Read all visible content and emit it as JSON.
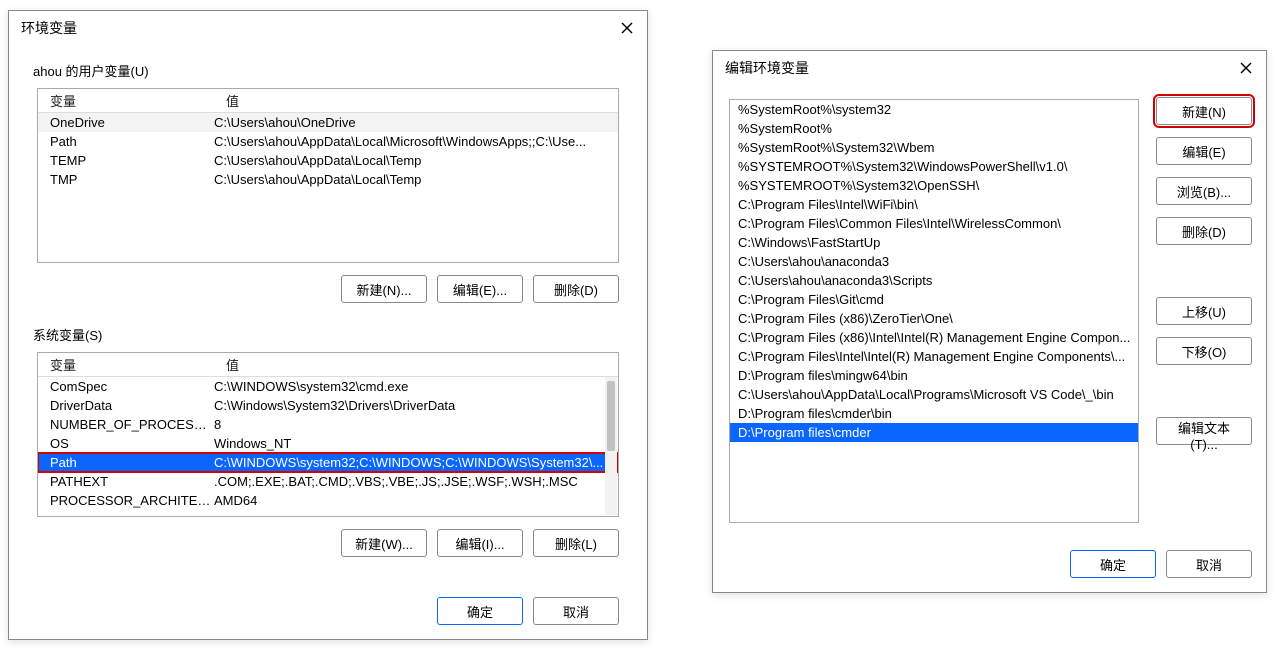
{
  "env": {
    "title": "环境变量",
    "user_section_label": "ahou 的用户变量(U)",
    "sys_section_label": "系统变量(S)",
    "headers": {
      "name": "变量",
      "value": "值"
    },
    "user_vars": [
      {
        "name": "OneDrive",
        "value": "C:\\Users\\ahou\\OneDrive"
      },
      {
        "name": "Path",
        "value": "C:\\Users\\ahou\\AppData\\Local\\Microsoft\\WindowsApps;;C:\\Use..."
      },
      {
        "name": "TEMP",
        "value": "C:\\Users\\ahou\\AppData\\Local\\Temp"
      },
      {
        "name": "TMP",
        "value": "C:\\Users\\ahou\\AppData\\Local\\Temp"
      }
    ],
    "sys_vars": [
      {
        "name": "ComSpec",
        "value": "C:\\WINDOWS\\system32\\cmd.exe"
      },
      {
        "name": "DriverData",
        "value": "C:\\Windows\\System32\\Drivers\\DriverData"
      },
      {
        "name": "NUMBER_OF_PROCESSORS",
        "value": "8"
      },
      {
        "name": "OS",
        "value": "Windows_NT"
      },
      {
        "name": "Path",
        "value": "C:\\WINDOWS\\system32;C:\\WINDOWS;C:\\WINDOWS\\System32\\..."
      },
      {
        "name": "PATHEXT",
        "value": ".COM;.EXE;.BAT;.CMD;.VBS;.VBE;.JS;.JSE;.WSF;.WSH;.MSC"
      },
      {
        "name": "PROCESSOR_ARCHITECTURE",
        "value": "AMD64"
      }
    ],
    "user_buttons": {
      "new": "新建(N)...",
      "edit": "编辑(E)...",
      "delete": "删除(D)"
    },
    "sys_buttons": {
      "new": "新建(W)...",
      "edit": "编辑(I)...",
      "delete": "删除(L)"
    },
    "footer": {
      "ok": "确定",
      "cancel": "取消"
    }
  },
  "edit": {
    "title": "编辑环境变量",
    "paths": [
      "%SystemRoot%\\system32",
      "%SystemRoot%",
      "%SystemRoot%\\System32\\Wbem",
      "%SYSTEMROOT%\\System32\\WindowsPowerShell\\v1.0\\",
      "%SYSTEMROOT%\\System32\\OpenSSH\\",
      "C:\\Program Files\\Intel\\WiFi\\bin\\",
      "C:\\Program Files\\Common Files\\Intel\\WirelessCommon\\",
      "C:\\Windows\\FastStartUp",
      "C:\\Users\\ahou\\anaconda3",
      "C:\\Users\\ahou\\anaconda3\\Scripts",
      "C:\\Program Files\\Git\\cmd",
      "C:\\Program Files (x86)\\ZeroTier\\One\\",
      "C:\\Program Files (x86)\\Intel\\Intel(R) Management Engine Compon...",
      "C:\\Program Files\\Intel\\Intel(R) Management Engine Components\\...",
      "D:\\Program files\\mingw64\\bin",
      "C:\\Users\\ahou\\AppData\\Local\\Programs\\Microsoft VS Code\\_\\bin",
      "D:\\Program files\\cmder\\bin",
      "D:\\Program files\\cmder"
    ],
    "selected_index": 17,
    "buttons": {
      "new": "新建(N)",
      "edit": "编辑(E)",
      "browse": "浏览(B)...",
      "delete": "删除(D)",
      "up": "上移(U)",
      "down": "下移(O)",
      "edittext": "编辑文本(T)..."
    },
    "footer": {
      "ok": "确定",
      "cancel": "取消"
    }
  }
}
